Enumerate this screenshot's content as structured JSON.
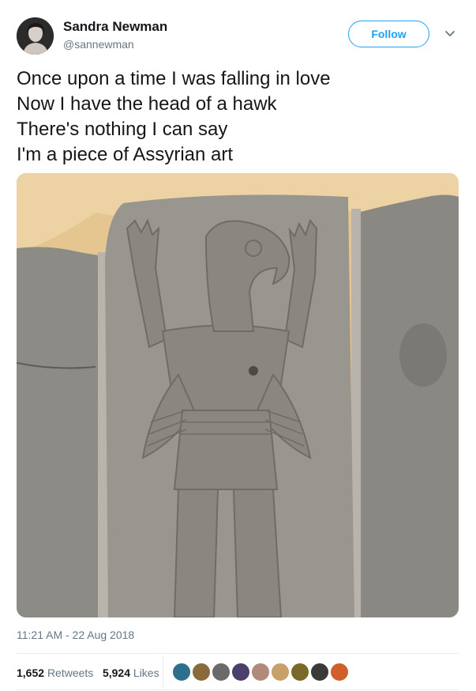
{
  "author": {
    "display_name": "Sandra Newman",
    "handle": "@sannewman"
  },
  "follow_button": {
    "label": "Follow"
  },
  "menu": {
    "icon": "chevron-down-icon"
  },
  "tweet": {
    "lines": [
      "Once upon a time I was falling in love",
      "Now I have the head of a hawk",
      "There's nothing I can say",
      "I'm a piece of Assyrian art"
    ],
    "timestamp": "11:21 AM - 22 Aug 2018"
  },
  "stats": {
    "retweets_count": "1,652",
    "retweets_label": "Retweets",
    "likes_count": "5,924",
    "likes_label": "Likes"
  },
  "likers": [
    {
      "color": "#2e6f8f"
    },
    {
      "color": "#8a6a3a"
    },
    {
      "color": "#6a6a6a"
    },
    {
      "color": "#4b3f6b"
    },
    {
      "color": "#b08a7a"
    },
    {
      "color": "#c8a06a"
    },
    {
      "color": "#7a6a2a"
    },
    {
      "color": "#3a3a3a"
    },
    {
      "color": "#d0602a"
    }
  ],
  "colors": {
    "accent": "#1da1f2",
    "secondary_text": "#657786",
    "primary_text": "#14171a"
  }
}
